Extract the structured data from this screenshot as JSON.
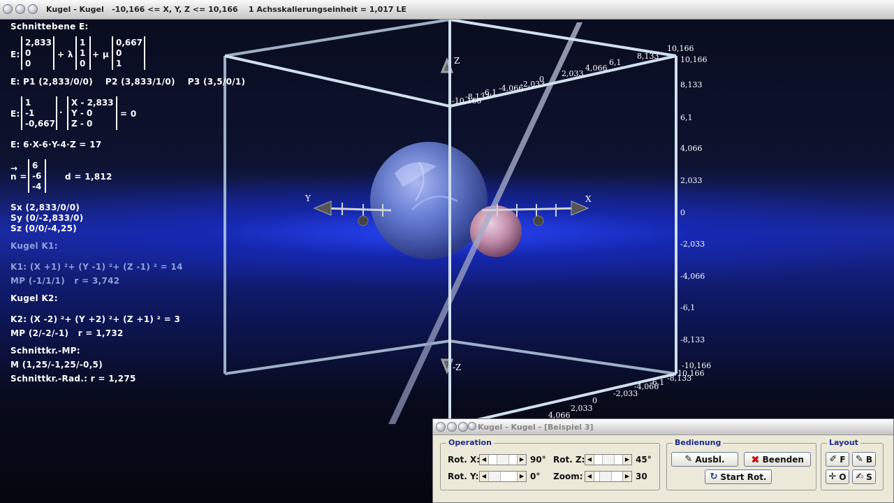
{
  "window": {
    "title": "Kugel - Kugel   -10,166 <= X, Y, Z <= 10,166    1 Achsskalierungseinheit = 1,017 LE"
  },
  "info": {
    "plane_title": "Schnittebene E:",
    "param_label": "E:",
    "param_v0": [
      "2,833",
      "0",
      "0"
    ],
    "plus_lambda": "+ λ",
    "param_v1": [
      "1",
      "1",
      "0"
    ],
    "plus_mu": "+ μ",
    "param_v2": [
      "0,667",
      "0",
      "1"
    ],
    "points": "E: P1 (2,833/0/0)    P2 (3,833/1/0)    P3 (3,5/0/1)",
    "normal_label": "E:",
    "normal_vec": [
      "1",
      "-1",
      "-0,667"
    ],
    "dot": "·",
    "xyz_vec": [
      "X - 2,833",
      "Y - 0",
      "Z - 0"
    ],
    "eq_zero": "= 0",
    "coord_form": "E: 6·X-6·Y-4·Z = 17",
    "n_arrow": "→",
    "n_label": "n =",
    "n_vec": [
      "6",
      "-6",
      "-4"
    ],
    "distance": "d = 1,812",
    "sx": "Sx (2,833/0/0)",
    "sy": "Sy (0/-2,833/0)",
    "sz": "Sz (0/0/-4,25)",
    "k1_title": "Kugel K1:",
    "k1_eq": "K1: (X +1) ²+ (Y -1) ²+ (Z -1) ² = 14",
    "k1_mp": "MP (-1/1/1)   r = 3,742",
    "k2_title": "Kugel K2:",
    "k2_eq": "K2: (X -2) ²+ (Y +2) ²+ (Z +1) ² = 3",
    "k2_mp": "MP (2/-2/-1)   r = 1,732",
    "circle_mp_title": "Schnittkr.-MP:",
    "circle_mp": "M (1,25/-1,25/-0,5)",
    "circle_radius": "Schnittkr.-Rad.: r = 1,275"
  },
  "scene": {
    "axis_x": "X",
    "axis_y": "Y",
    "axis_z": "Z",
    "axis_neg_z": "-Z",
    "right_ticks": [
      "10,166",
      "10,166",
      "8,133",
      "6,1",
      "4,066",
      "2,033",
      "0",
      "-2,033",
      "-4,066",
      "-6,1",
      "-8,133",
      "-10,166",
      "10,166"
    ],
    "top_ticks": [
      "-10,166",
      "-8,133",
      "-6,1",
      "-4,066",
      "-2,033",
      "0",
      "2,033",
      "4,066",
      "6,1",
      "8,133"
    ],
    "bottom_ticks": [
      "-8,133",
      "-6,1",
      "-4,066",
      "-2,033",
      "0",
      "2,033",
      "4,066"
    ]
  },
  "panel": {
    "title": "Kugel - Kugel - [Beispiel 3]",
    "operation_legend": "Operation",
    "rot_x_label": "Rot. X:",
    "rot_x_value": "90°",
    "rot_y_label": "Rot. Y:",
    "rot_y_value": "0°",
    "rot_z_label": "Rot. Z:",
    "rot_z_value": "45°",
    "zoom_label": "Zoom:",
    "zoom_value": "30",
    "bedienung_legend": "Bedienung",
    "ausbl_label": "Ausbl.",
    "beenden_label": "Beenden",
    "start_rot_label": "Start Rot.",
    "layout_legend": "Layout",
    "layout_f": "F",
    "layout_b": "B",
    "layout_o": "O",
    "layout_s": "S"
  },
  "colors": {
    "sphere1": "#6f86d8",
    "sphere2": "#d9a6b8",
    "frame": "#cfe0ee",
    "plane": "#a0a6c8"
  }
}
